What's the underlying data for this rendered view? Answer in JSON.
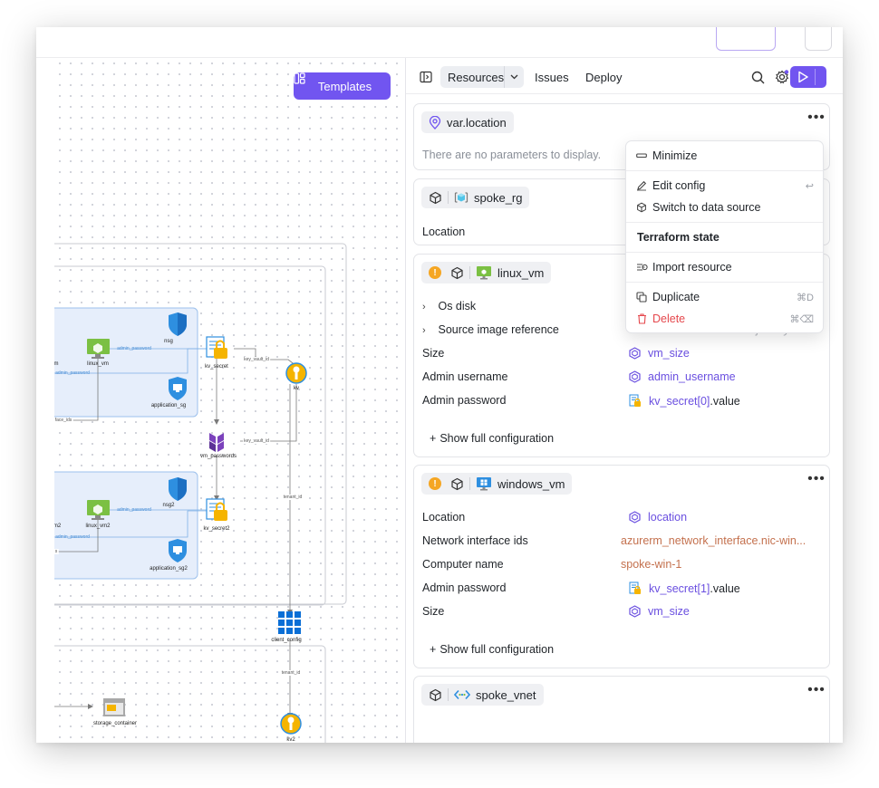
{
  "toolbar": {
    "tabs": [
      {
        "label": "Resources",
        "active": true
      },
      {
        "label": "Issues"
      },
      {
        "label": "Deploy"
      }
    ]
  },
  "canvas": {
    "templates_label": "Templates",
    "nodes": [
      {
        "label": "nsg"
      },
      {
        "label": "linux_vm"
      },
      {
        "label": "kv_secret"
      },
      {
        "label": "kv"
      },
      {
        "label": "application_sg"
      },
      {
        "label": "vm_passwords"
      },
      {
        "label": "nsg2"
      },
      {
        "label": "linux_vm2"
      },
      {
        "label": "kv_secret2"
      },
      {
        "label": "application_sg2"
      },
      {
        "label": "client_config"
      },
      {
        "label": "storage_container"
      },
      {
        "label": "kv2"
      },
      {
        "label": "m"
      },
      {
        "label": "m2"
      }
    ],
    "edges": [
      {
        "label": "admin_password"
      },
      {
        "label": "admin_password"
      },
      {
        "label": "key_vault_id"
      },
      {
        "label": "key_vault_id"
      },
      {
        "label": "face_ids"
      },
      {
        "label": "admin_password"
      },
      {
        "label": "admin_password"
      },
      {
        "label": "s"
      },
      {
        "label": "tenant_id"
      },
      {
        "label": "tenant_id"
      }
    ]
  },
  "cards": [
    {
      "title": "var.location",
      "icon": "location-pin-icon",
      "empty_text": "There are no parameters to display."
    },
    {
      "title": "spoke_rg",
      "icon": "resource-group-icon",
      "rows": [
        {
          "label": "Location",
          "value": ""
        }
      ]
    },
    {
      "title": "linux_vm",
      "icon": "linux-vm-icon",
      "warning": true,
      "rows": [
        {
          "label": "Os disk",
          "expandable": true
        },
        {
          "label": "Source image reference",
          "expandable": true,
          "value": "0001-com-ubuntu-server-jammy"
        },
        {
          "label": "Size",
          "value": "vm_size"
        },
        {
          "label": "Admin username",
          "value": "admin_username"
        },
        {
          "label": "Admin password",
          "value_ref": "kv_secret[0]",
          "value_suffix": ".value"
        }
      ],
      "show_full": "Show full configuration"
    },
    {
      "title": "windows_vm",
      "icon": "windows-vm-icon",
      "warning": true,
      "rows": [
        {
          "label": "Location",
          "value": "location"
        },
        {
          "label": "Network interface ids",
          "value": "azurerm_network_interface.nic-win..."
        },
        {
          "label": "Computer name",
          "value": "spoke-win-1"
        },
        {
          "label": "Admin password",
          "value_ref": "kv_secret[1]",
          "value_suffix": ".value"
        },
        {
          "label": "Size",
          "value": "vm_size"
        }
      ],
      "show_full": "Show full configuration"
    },
    {
      "title": "spoke_vnet",
      "icon": "vnet-icon"
    }
  ],
  "menu": {
    "items": [
      {
        "label": "Minimize",
        "icon": "minimize-icon"
      },
      {
        "label": "Edit config",
        "icon": "pencil-icon",
        "shortcut": "↩"
      },
      {
        "label": "Switch to data source",
        "icon": "cube-icon"
      },
      {
        "label": "Terraform state",
        "header": true
      },
      {
        "label": "Import resource",
        "icon": "import-icon"
      },
      {
        "label": "Duplicate",
        "icon": "duplicate-icon",
        "shortcut": "⌘D"
      },
      {
        "label": "Delete",
        "icon": "trash-icon",
        "shortcut": "⌘⌫",
        "danger": true
      }
    ]
  },
  "colors": {
    "accent": "#7155f0",
    "reference": "#6a4fe0",
    "literal": "#c4714e",
    "danger": "#e5484d",
    "warning": "#f5a623"
  }
}
